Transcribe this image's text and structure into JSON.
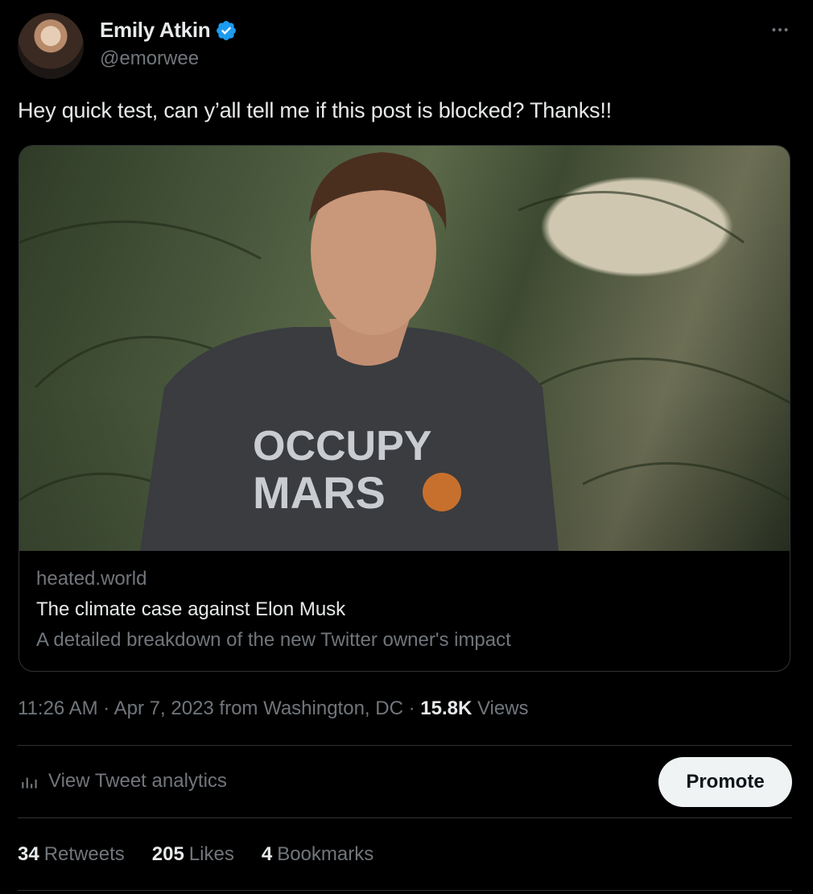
{
  "author": {
    "name": "Emily Atkin",
    "handle": "@emorwee",
    "verified": true
  },
  "post": {
    "text": "Hey quick test, can y’all tell me if this post is blocked? Thanks!!"
  },
  "card": {
    "image_shirt_text_line1": "OCCUPY",
    "image_shirt_text_line2": "MARS",
    "domain": "heated.world",
    "title": "The climate case against Elon Musk",
    "description": "A detailed breakdown of the new Twitter owner's impact"
  },
  "meta": {
    "time": "11:26 AM",
    "sep1": " · ",
    "date": "Apr 7, 2023",
    "location": " from Washington, DC",
    "sep2": " · ",
    "views_count": "15.8K",
    "views_label": " Views"
  },
  "analytics": {
    "label": "View Tweet analytics"
  },
  "promote": {
    "label": "Promote"
  },
  "stats": {
    "retweets_count": "34",
    "retweets_label": "Retweets",
    "likes_count": "205",
    "likes_label": "Likes",
    "bookmarks_count": "4",
    "bookmarks_label": "Bookmarks"
  },
  "colors": {
    "background": "#000000",
    "text_primary": "#e7e9ea",
    "text_secondary": "#71767b",
    "verified_blue": "#1d9bf0",
    "button_bg": "#eff3f4"
  },
  "icons": {
    "verified": "verified-badge-icon",
    "more": "more-horizontal-icon",
    "analytics": "bar-chart-icon"
  }
}
